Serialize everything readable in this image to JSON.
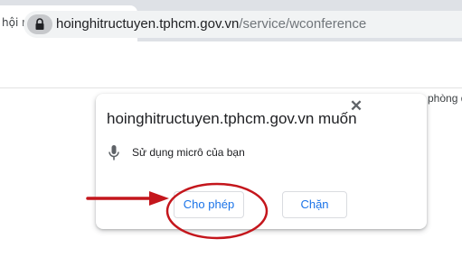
{
  "tab": {
    "title": "hội nghị trực tuyến TP",
    "close_glyph": "✕"
  },
  "new_tab": {
    "glyph": "+"
  },
  "address_bar": {
    "host": "hoinghitructuyen.tphcm.gov.vn",
    "path": "/service/wconference"
  },
  "bookmark_snippet": "phòng đi",
  "permission_popup": {
    "title": "hoinghitructuyen.tphcm.gov.vn muốn",
    "close_glyph": "✕",
    "permission_icon": "microphone-icon",
    "permission_text": "Sử dụng micrô của bạn",
    "allow_label": "Cho phép",
    "block_label": "Chặn"
  },
  "annotation": {
    "color": "#c4161c"
  }
}
